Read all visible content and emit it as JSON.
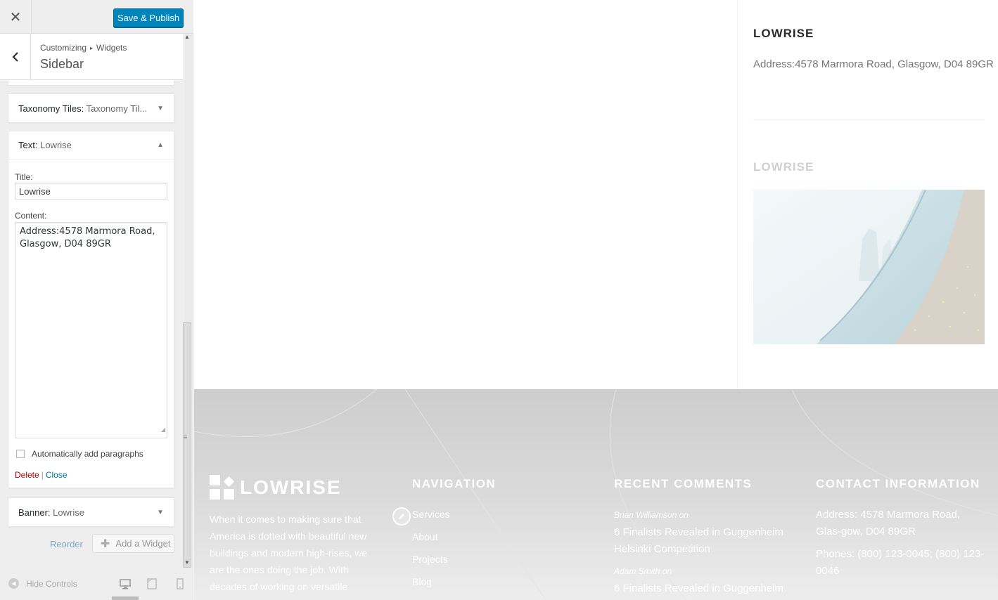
{
  "customizer": {
    "close_icon": "close-icon",
    "publish_label": "Save & Publish",
    "breadcrumb": {
      "root": "Customizing",
      "separator": "▸",
      "current": "Widgets"
    },
    "section_title": "Sidebar",
    "widgets": {
      "taxonomy": {
        "type": "Taxonomy Tiles:",
        "title": "Taxonomy Til..."
      },
      "text": {
        "type": "Text:",
        "title": "Lowrise",
        "title_label": "Title:",
        "title_value": "Lowrise",
        "content_label": "Content:",
        "content_value": "Address:4578 Marmora Road,\nGlasgow, D04 89GR",
        "auto_paragraphs_label": "Automatically add paragraphs",
        "auto_paragraphs_checked": false,
        "delete_label": "Delete",
        "separator": "|",
        "close_label": "Close"
      },
      "banner": {
        "type": "Banner:",
        "title": "Lowrise"
      }
    },
    "reorder_label": "Reorder",
    "add_widget_label": "Add a Widget",
    "hide_controls_label": "Hide Controls",
    "devices": [
      "desktop-icon",
      "tablet-icon",
      "mobile-icon"
    ],
    "active_device": "desktop",
    "accent_color": "#0085ba"
  },
  "preview": {
    "sidebar_widget_1": {
      "title": "LOWRISE",
      "text": "Address:4578 Marmora Road, Glasgow, D04 89GR"
    },
    "sidebar_widget_2": {
      "title": "LOWRISE"
    },
    "footer": {
      "logo_text": "LOWRISE",
      "about": "When it comes to making sure that America is dotted with beautiful new buildings and modern high-rises, we are the ones doing the job. With decades of working on versatile",
      "navigation_title": "NAVIGATION",
      "navigation": [
        "Services",
        "About",
        "Projects",
        "Blog"
      ],
      "recent_comments_title": "RECENT COMMENTS",
      "comments": [
        {
          "author": "Brian Williamson",
          "on": "on",
          "post": "6 Finalists Revealed in Guggenheim Helsinki Competition"
        },
        {
          "author": "Adam Smith",
          "on": "on",
          "post": "6 Finalists Revealed in Guggenheim"
        }
      ],
      "contact_title": "CONTACT INFORMATION",
      "contact_address": "Address: 4578 Marmora Road, Glas-gow, D04 89GR",
      "contact_phones": "Phones: (800) 123-0045; (800) 123-0046"
    }
  }
}
